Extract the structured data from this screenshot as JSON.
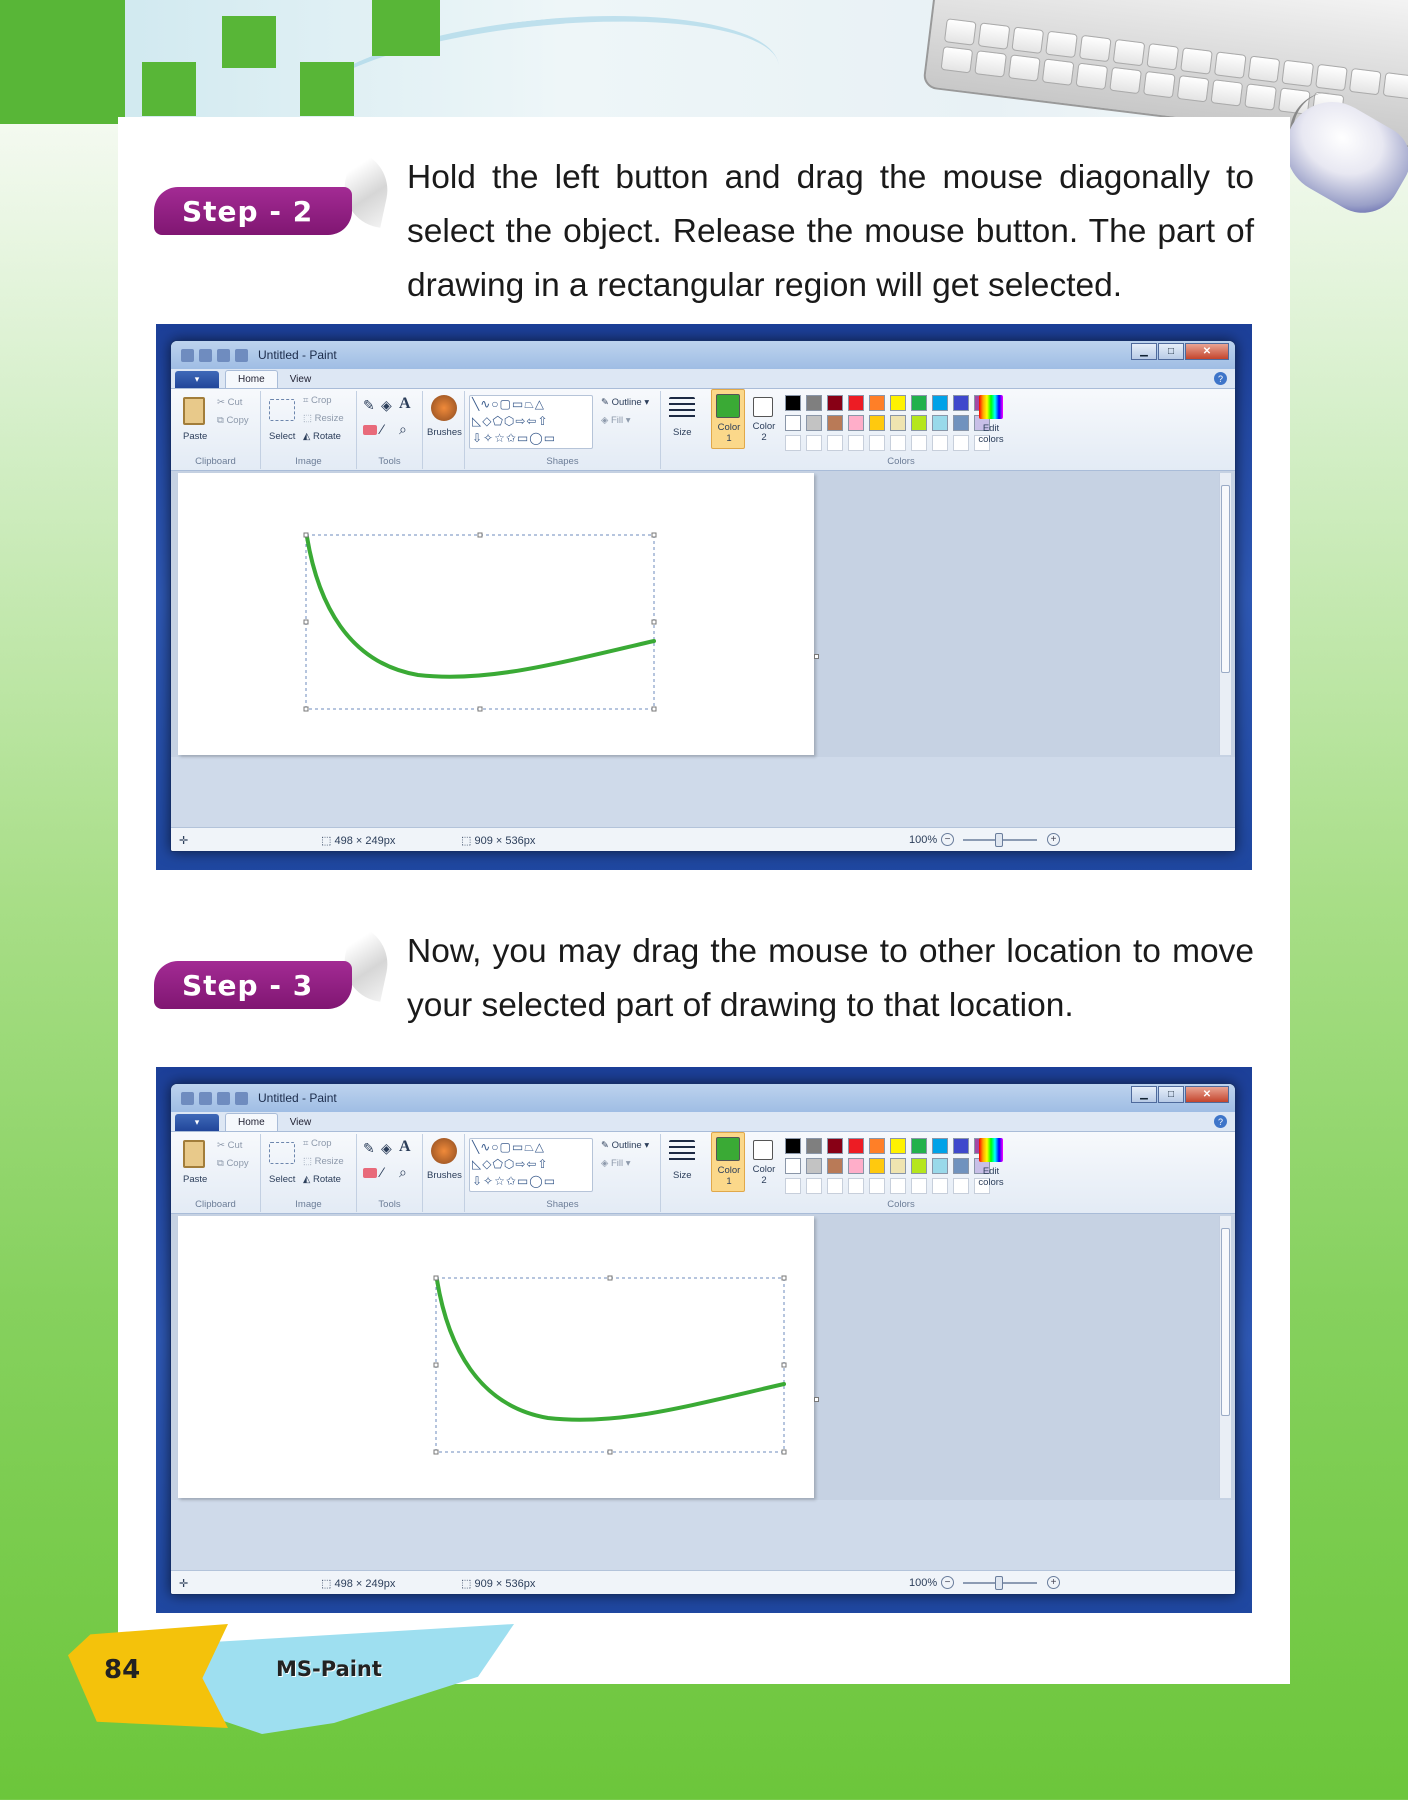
{
  "page": {
    "number": "84",
    "book_title": "MS-Paint",
    "colors": {
      "green": "#58b637",
      "step_badge": "#8d1c80",
      "footer_yellow": "#f4c20b",
      "footer_cyan": "#9edff0"
    }
  },
  "steps": [
    {
      "label": "Step - 2",
      "text": "Hold the left button and drag the mouse diagonally to select the object. Release the mouse button. The part of drawing in a rectangular region will get selected."
    },
    {
      "label": "Step - 3",
      "text": "Now, you may drag the mouse to other location to move your selected part of drawing to that location."
    }
  ],
  "paint_window": {
    "title": "Untitled - Paint",
    "app_menu": "▾",
    "tabs": [
      "Home",
      "View"
    ],
    "clipboard": {
      "paste": "Paste",
      "cut": "Cut",
      "copy": "Copy",
      "group": "Clipboard"
    },
    "image": {
      "select": "Select",
      "crop": "Crop",
      "resize": "Resize",
      "rotate": "Rotate",
      "group": "Image"
    },
    "tools": {
      "group": "Tools",
      "brushes": "Brushes"
    },
    "shapes": {
      "outline": "Outline",
      "fill": "Fill",
      "group": "Shapes"
    },
    "size": "Size",
    "color1": [
      "Color",
      "1"
    ],
    "color2": [
      "Color",
      "2"
    ],
    "edit_colors": [
      "Edit",
      "colors"
    ],
    "colors_group": "Colors",
    "palette_row1": [
      "#000000",
      "#7f7f7f",
      "#880015",
      "#ed1c24",
      "#ff7f27",
      "#fff200",
      "#22b14c",
      "#00a2e8",
      "#3f48cc",
      "#a349a4"
    ],
    "palette_row2": [
      "#ffffff",
      "#c3c3c3",
      "#b97a57",
      "#ffaec9",
      "#ffc90e",
      "#efe4b0",
      "#b5e61d",
      "#99d9ea",
      "#7092be",
      "#c8bfe7"
    ],
    "stroke_color": "#3aaa35",
    "status": {
      "selection_size": "498 × 249px",
      "canvas_size": "909 × 536px",
      "zoom": "100%"
    }
  }
}
